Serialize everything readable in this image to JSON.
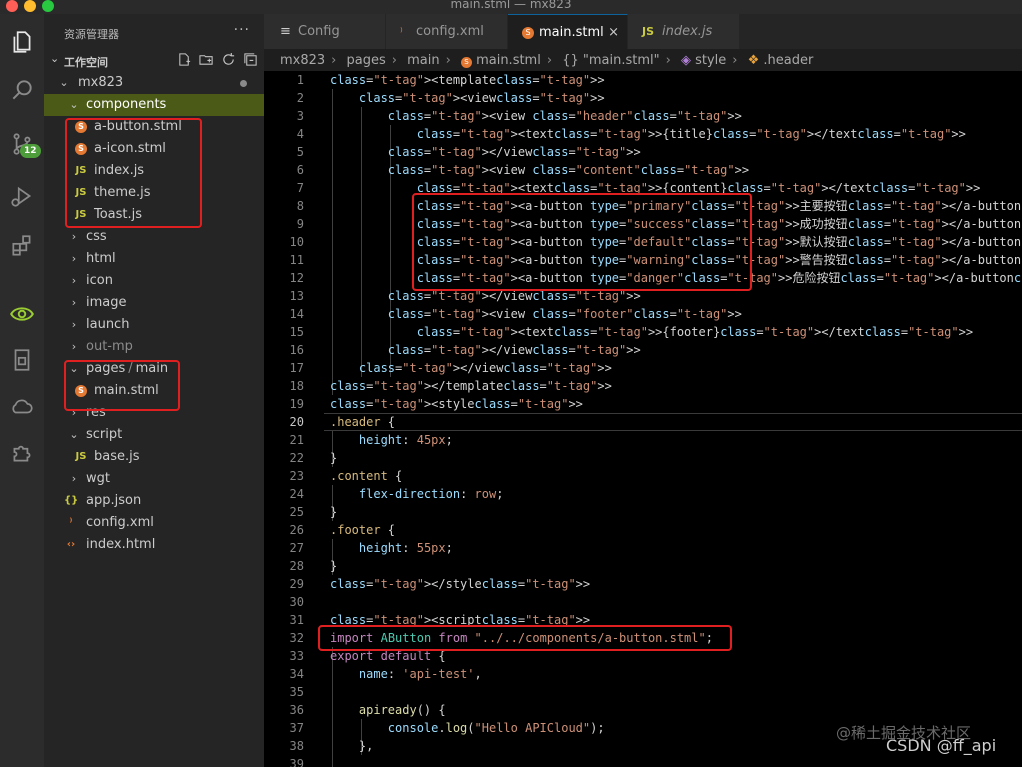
{
  "window": {
    "title": "main.stml — mx823"
  },
  "activity_bar": {
    "items": [
      {
        "icon": "files-icon"
      },
      {
        "icon": "search-icon"
      },
      {
        "icon": "source-control-icon",
        "badge": "12"
      },
      {
        "icon": "run-debug-icon"
      },
      {
        "icon": "extensions-icon"
      },
      {
        "icon": "eye-icon"
      },
      {
        "icon": "remote-explorer-icon"
      },
      {
        "icon": "cloud-icon"
      },
      {
        "icon": "puzzle-icon"
      }
    ]
  },
  "sidebar": {
    "title": "资源管理器",
    "more": "···",
    "workspace_label": "工作空间",
    "tree": [
      {
        "label": "mx823",
        "type": "folder",
        "open": true
      },
      {
        "label": "components",
        "type": "folder",
        "open": true
      },
      {
        "label": "a-button.stml",
        "type": "stml"
      },
      {
        "label": "a-icon.stml",
        "type": "stml"
      },
      {
        "label": "index.js",
        "type": "js"
      },
      {
        "label": "theme.js",
        "type": "js"
      },
      {
        "label": "Toast.js",
        "type": "js"
      },
      {
        "label": "css",
        "type": "folder",
        "open": false
      },
      {
        "label": "html",
        "type": "folder",
        "open": false
      },
      {
        "label": "icon",
        "type": "folder",
        "open": false
      },
      {
        "label": "image",
        "type": "folder",
        "open": false
      },
      {
        "label": "launch",
        "type": "folder",
        "open": false
      },
      {
        "label": "out-mp",
        "type": "folder",
        "open": false
      },
      {
        "label": "pages",
        "label2": "main",
        "type": "folder",
        "open": true
      },
      {
        "label": "main.stml",
        "type": "stml"
      },
      {
        "label": "res",
        "type": "folder",
        "open": false
      },
      {
        "label": "script",
        "type": "folder",
        "open": true
      },
      {
        "label": "base.js",
        "type": "js"
      },
      {
        "label": "wgt",
        "type": "folder",
        "open": false
      },
      {
        "label": "app.json",
        "type": "json"
      },
      {
        "label": "config.xml",
        "type": "xml"
      },
      {
        "label": "index.html",
        "type": "html"
      }
    ]
  },
  "tabs": [
    {
      "label": "Config",
      "icon": "≡"
    },
    {
      "label": "config.xml",
      "icon": "⁾"
    },
    {
      "label": "main.stml",
      "icon": "S",
      "close": "×"
    },
    {
      "label": "index.js",
      "icon": "JS"
    }
  ],
  "breadcrumb": [
    "mx823",
    "pages",
    "main",
    "main.stml",
    "{} \"main.stml\"",
    "style",
    ".header"
  ],
  "editor": {
    "current_line": 20,
    "lines": [
      "<template>",
      "    <view>",
      "        <view class=\"header\">",
      "            <text>{title}</text>",
      "        </view>",
      "        <view class=\"content\">",
      "            <text>{content}</text>",
      "            <a-button type=\"primary\">主要按钮</a-button>",
      "            <a-button type=\"success\">成功按钮</a-button>",
      "            <a-button type=\"default\">默认按钮</a-button>",
      "            <a-button type=\"warning\">警告按钮</a-button>",
      "            <a-button type=\"danger\">危险按钮</a-button>",
      "        </view>",
      "        <view class=\"footer\">",
      "            <text>{footer}</text>",
      "        </view>",
      "    </view>",
      "</template>",
      "<style>",
      ".header {",
      "    height: 45px;",
      "}",
      ".content {",
      "    flex-direction: row;",
      "}",
      ".footer {",
      "    height: 55px;",
      "}",
      "</style>",
      "",
      "<script>",
      "import AButton from \"../../components/a-button.stml\";",
      "export default {",
      "    name: 'api-test',",
      "",
      "    apiready() {",
      "        console.log(\"Hello APICloud\");",
      "    },",
      ""
    ]
  },
  "overlay": {
    "watermark": "@稀土掘金技术社区",
    "credit": "CSDN @ff_api"
  },
  "colors": {
    "highlight_red": "#e02020",
    "selection": "#4b5a16",
    "accent_blue": "#0e639c"
  }
}
